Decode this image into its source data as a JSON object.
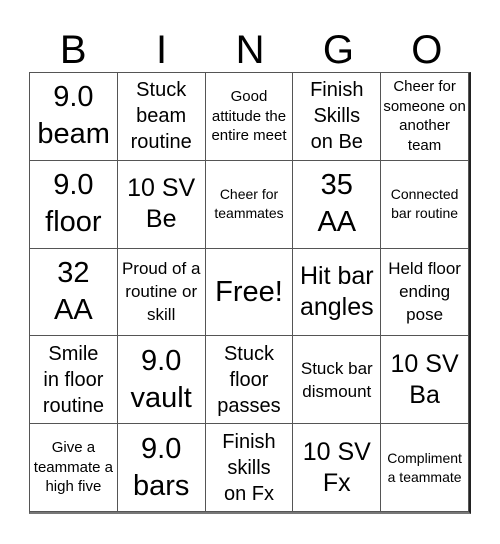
{
  "header": [
    "B",
    "I",
    "N",
    "G",
    "O"
  ],
  "cells": [
    [
      "9.0 beam",
      "Stuck beam routine",
      "Good attitude the entire meet",
      "Finish Skills on Be",
      "Cheer for someone on another team"
    ],
    [
      "9.0 floor",
      "10 SV Be",
      "Cheer for teammates",
      "35 AA",
      "Connected bar routine"
    ],
    [
      "32 AA",
      "Proud of a routine or skill",
      "Free!",
      "Hit bar angles",
      "Held floor ending pose"
    ],
    [
      "Smile in floor routine",
      "9.0 vault",
      "Stuck floor passes",
      "Stuck bar dismount",
      "10 SV Ba"
    ],
    [
      "Give a teammate a high five",
      "9.0 bars",
      "Finish skills on Fx",
      "10 SV Fx",
      "Compliment a teammate"
    ]
  ]
}
